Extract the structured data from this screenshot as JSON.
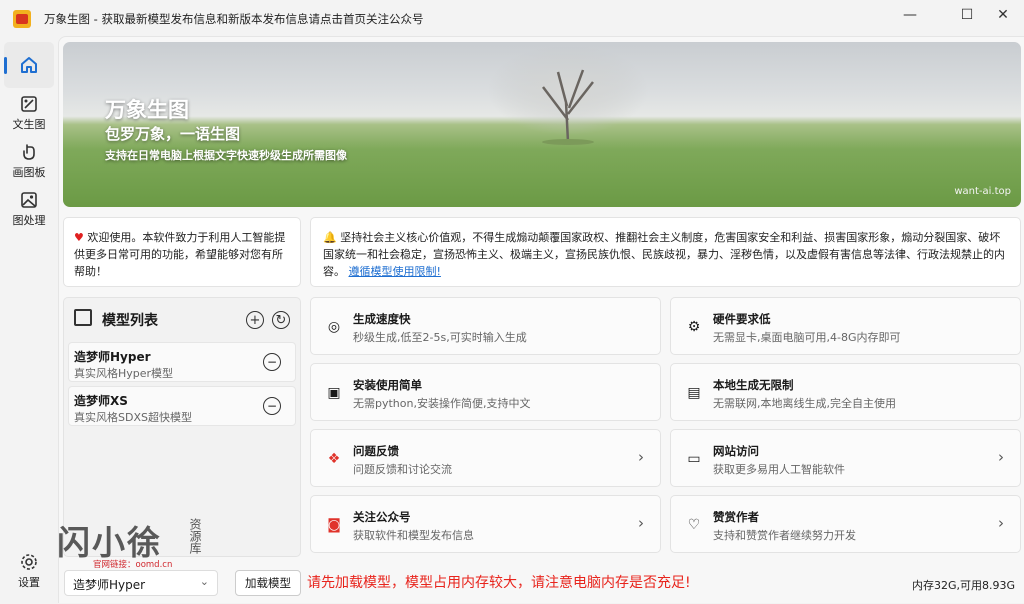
{
  "window": {
    "title": "万象生图 - 获取最新模型发布信息和新版本发布信息请点击首页关注公众号",
    "minimize": "—",
    "maximize": "☐",
    "close": "✕"
  },
  "sidebar": {
    "items": [
      {
        "label": "",
        "icon": "home-icon"
      },
      {
        "label": "文生图",
        "icon": "text-to-image-icon"
      },
      {
        "label": "画图板",
        "icon": "drawing-board-icon"
      },
      {
        "label": "图处理",
        "icon": "image-processing-icon"
      }
    ],
    "settings_label": "设置"
  },
  "banner": {
    "title": "万象生图",
    "subtitle": "包罗万象，一语生图",
    "description": "支持在日常电脑上根据文字快速秒级生成所需图像",
    "url": "want-ai.top"
  },
  "welcome": {
    "text": "欢迎使用。本软件致力于利用人工智能提供更多日常可用的功能，希望能够对您有所帮助！"
  },
  "notice": {
    "text": "坚持社会主义核心价值观，不得生成煽动颠覆国家政权、推翻社会主义制度，危害国家安全和利益、损害国家形象，煽动分裂国家、破坏国家统一和社会稳定，宣扬恐怖主义、极端主义，宣扬民族仇恨、民族歧视，暴力、淫秽色情，以及虚假有害信息等法律、行政法规禁止的内容。",
    "link": "遵循模型使用限制!"
  },
  "model_list": {
    "title": "模型列表",
    "models": [
      {
        "name": "造梦师Hyper",
        "desc": "真实风格Hyper模型"
      },
      {
        "name": "造梦师XS",
        "desc": "真实风格SDXS超快模型"
      }
    ]
  },
  "features": [
    {
      "title": "生成速度快",
      "desc": "秒级生成,低至2-5s,可实时输入生成",
      "icon": "speed-icon",
      "arrow": ""
    },
    {
      "title": "硬件要求低",
      "desc": "无需显卡,桌面电脑可用,4-8G内存即可",
      "icon": "chip-icon",
      "arrow": ""
    },
    {
      "title": "安装使用简单",
      "desc": "无需python,安装操作简便,支持中文",
      "icon": "install-icon",
      "arrow": ""
    },
    {
      "title": "本地生成无限制",
      "desc": "无需联网,本地离线生成,完全自主使用",
      "icon": "local-icon",
      "arrow": ""
    },
    {
      "title": "问题反馈",
      "desc": "问题反馈和讨论交流",
      "icon": "feedback-icon",
      "arrow": "›"
    },
    {
      "title": "网站访问",
      "desc": "获取更多易用人工智能软件",
      "icon": "website-icon",
      "arrow": "›"
    },
    {
      "title": "关注公众号",
      "desc": "获取软件和模型发布信息",
      "icon": "wechat-icon",
      "arrow": "›"
    },
    {
      "title": "赞赏作者",
      "desc": "支持和赞赏作者继续努力开发",
      "icon": "donate-icon",
      "arrow": "›"
    }
  ],
  "bottom": {
    "selected_model": "造梦师Hyper",
    "load_button": "加载模型",
    "warning": "请先加载模型，模型占用内存较大，请注意电脑内存是否充足!",
    "memory": "内存32G,可用8.93G"
  },
  "watermark": {
    "big": "闪小徐",
    "side": "资源库",
    "small": "官网链接：oomd.cn"
  },
  "colors": {
    "accent": "#1f6fd1",
    "warning": "#e8241c"
  }
}
